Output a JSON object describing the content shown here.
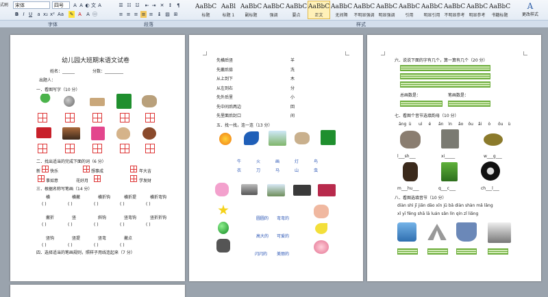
{
  "toolbar": {
    "font_name": "宋体",
    "font_size": "四号",
    "left_nav_label": "式刷",
    "group_labels": {
      "font": "字体",
      "paragraph": "段落",
      "styles": "样式"
    },
    "change_styles_label": "更改样式"
  },
  "styles_gallery": [
    {
      "sample": "AaBbC",
      "name": "标题"
    },
    {
      "sample": "AaBl",
      "name": "标题 1"
    },
    {
      "sample": "AaBbC",
      "name": "副标题"
    },
    {
      "sample": "AaBbCcD",
      "name": "强调"
    },
    {
      "sample": "AaBbCcD",
      "name": "要点"
    },
    {
      "sample": "AaBbCcDc",
      "name": "正文",
      "active": true
    },
    {
      "sample": "AaBbCcDc",
      "name": "无间隔"
    },
    {
      "sample": "AaBbCcDc",
      "name": "不明显强调"
    },
    {
      "sample": "AaBbCcDc",
      "name": "明显强调"
    },
    {
      "sample": "AaBbCcDc",
      "name": "引用"
    },
    {
      "sample": "AaBbCcDc",
      "name": "明显引用"
    },
    {
      "sample": "AaBbCcD",
      "name": "不明显参考"
    },
    {
      "sample": "AaBbCcI",
      "name": "明显参考"
    },
    {
      "sample": "AaBbCcI",
      "name": "书籍标题"
    }
  ],
  "page1": {
    "title": "幼儿园大班期末语文试卷",
    "name_line": "姓名：______",
    "score_line": "分数：_________",
    "author": "出题人：",
    "q1": "一．看图写字（10 分）",
    "q2": "二．找出适当的完成下面的词（6 分）",
    "q2_items": [
      "新",
      "快乐",
      "想事成",
      "年大吉",
      "事如意",
      "花好月",
      "学发财"
    ],
    "q3": "三．根据名称写笔画（14 分）",
    "strokes_row1": [
      "横",
      "横撇",
      "横折钩",
      "横折提",
      "横折弯钩"
    ],
    "strokes_row2": [
      "撇折",
      "竖",
      "斜钩",
      "竖弯钩",
      "竖折折钩"
    ],
    "strokes_row3": [
      "竖钩",
      "竖提",
      "竖弯",
      "撇点"
    ],
    "paren": "(          )",
    "q4": "四．选择适当的笔画规则，照样子用线连起来（7 分）"
  },
  "page2": {
    "rules": [
      {
        "left": "先横后竖",
        "right": "羊"
      },
      {
        "left": "先撇后捺",
        "right": "洗"
      },
      {
        "left": "从上到下",
        "right": "木"
      },
      {
        "left": "从左到右",
        "right": "分"
      },
      {
        "left": "先外后里",
        "right": "小"
      },
      {
        "left": "先中间后两边",
        "right": "回"
      },
      {
        "left": "先里面后封口",
        "right": "间"
      }
    ],
    "q5": "五．找一找，连一连（13 分）",
    "words_row1": [
      "牛",
      "火",
      "画",
      "灯",
      "鸟"
    ],
    "words_row2": [
      "衣",
      "刀",
      "马",
      "山",
      "虫"
    ],
    "adj": [
      "圆圆的",
      "弯弯的",
      "高大的",
      "可爱的",
      "闪闪的",
      "美丽的"
    ]
  },
  "page3": {
    "q6": "六．说说下面的字有几个，算一算有几个（20 分）",
    "count1": "总画数是：",
    "count2": "笔画数是：",
    "q7": "七．看图个音节选填韵母（10 分）",
    "pinyin_row": [
      "āng",
      "ü",
      "uì",
      "é",
      "ǎn",
      "ìn",
      "ǎo",
      "ǒu",
      "ǎi",
      "ò",
      "ǒu",
      "ù"
    ],
    "fill1": [
      "l___sh___",
      "xi_____",
      "w___g___"
    ],
    "fill2": [
      "m___hu___",
      "q___c___",
      "ch___l___"
    ],
    "q8": "八．看图选填音节（10 分）",
    "syll_row1": "diàn shì jī   jiǎn dāo   xīn jū bǎ   diàn shàn   mǎ lǎng",
    "syll_row2": "xǐ yī fěng   shā lā luán   sǎn lín   qín zǐ   liǎng"
  }
}
